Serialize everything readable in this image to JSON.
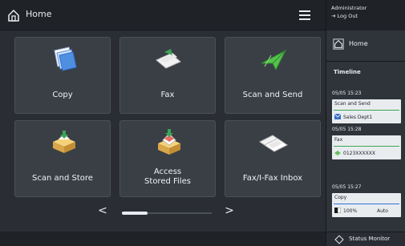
{
  "header": {
    "title": "Home"
  },
  "tiles": [
    {
      "label": "Copy",
      "icon": "copy-icon"
    },
    {
      "label": "Fax",
      "icon": "fax-icon"
    },
    {
      "label": "Scan and Send",
      "icon": "scan-and-send-icon"
    },
    {
      "label": "Scan and Store",
      "icon": "scan-and-store-icon"
    },
    {
      "label": "Access\nStored Files",
      "label_line1": "Access",
      "label_line2": "Stored Files",
      "icon": "access-stored-files-icon"
    },
    {
      "label": "Fax/I-Fax Inbox",
      "icon": "fax-inbox-icon"
    }
  ],
  "pager": {
    "prev": "<",
    "next": ">"
  },
  "side": {
    "user": "Administrator",
    "logout": "Log Out",
    "home_label": "Home",
    "timeline_title": "Timeline",
    "jobs": [
      {
        "time": "05/05 15:23",
        "type": "Scan and Send",
        "dest": "Sales Dept1",
        "accent": "#3aa655"
      },
      {
        "time": "05/05 15:28",
        "type": "Fax",
        "dest": "0123XXXXXX",
        "accent": "#3aa655"
      },
      {
        "time": "05/05 15:27",
        "type": "Copy",
        "dest": "100%",
        "dest2": "Auto",
        "accent": "#2f6fd6"
      }
    ],
    "status_monitor": "Status Monitor"
  },
  "colors": {
    "background": "#2a2e34",
    "tile": "#3a3f46",
    "panel": "#2f343b",
    "success": "#3aa655",
    "copy_accent": "#2f6fd6"
  }
}
